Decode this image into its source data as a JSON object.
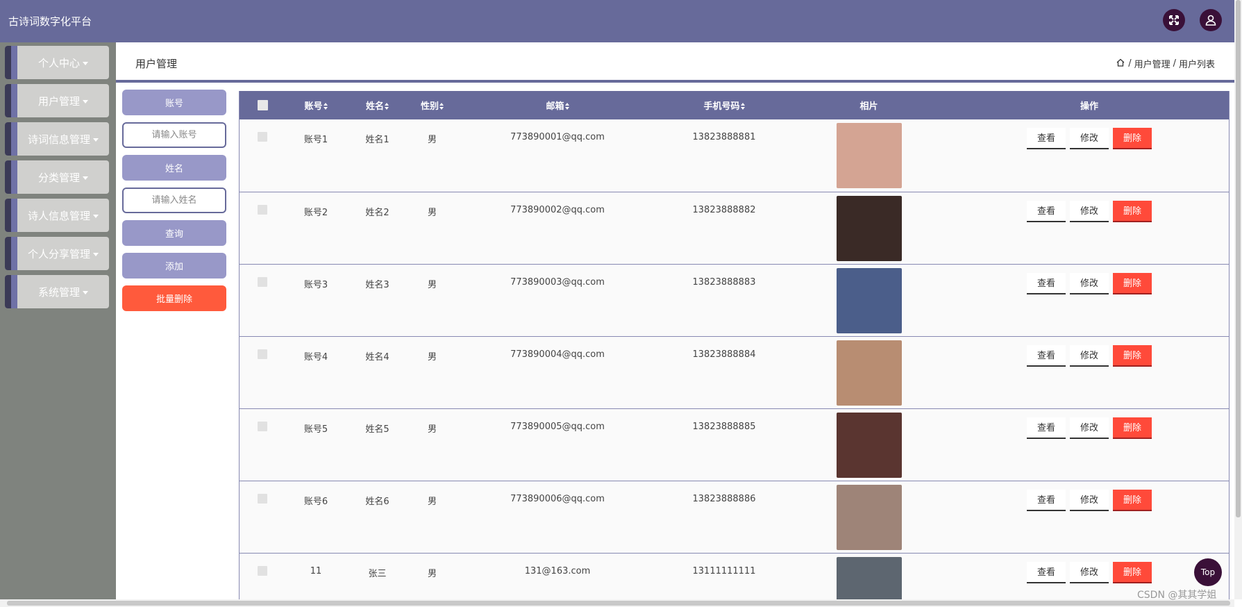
{
  "header": {
    "title": "古诗词数字化平台"
  },
  "sidebar": {
    "items": [
      {
        "label": "个人中心"
      },
      {
        "label": "用户管理"
      },
      {
        "label": "诗词信息管理"
      },
      {
        "label": "分类管理"
      },
      {
        "label": "诗人信息管理"
      },
      {
        "label": "个人分享管理"
      },
      {
        "label": "系统管理"
      }
    ]
  },
  "page": {
    "title": "用户管理",
    "breadcrumb": [
      "用户管理",
      "用户列表"
    ],
    "breadcrumb_sep": "/"
  },
  "search": {
    "account_label": "账号",
    "account_placeholder": "请输入账号",
    "name_label": "姓名",
    "name_value": "请输入姓名",
    "query_label": "查询",
    "add_label": "添加",
    "batch_delete_label": "批量删除"
  },
  "table": {
    "headers": {
      "account": "账号",
      "name": "姓名",
      "gender": "性别",
      "email": "邮箱",
      "phone": "手机号码",
      "photo": "相片",
      "actions": "操作"
    },
    "rows": [
      {
        "account": "账号1",
        "name": "姓名1",
        "gender": "男",
        "email": "773890001@qq.com",
        "phone": "13823888881",
        "photo_color": "#d4a493"
      },
      {
        "account": "账号2",
        "name": "姓名2",
        "gender": "男",
        "email": "773890002@qq.com",
        "phone": "13823888882",
        "photo_color": "#3a2a26"
      },
      {
        "account": "账号3",
        "name": "姓名3",
        "gender": "男",
        "email": "773890003@qq.com",
        "phone": "13823888883",
        "photo_color": "#4b5e8a"
      },
      {
        "account": "账号4",
        "name": "姓名4",
        "gender": "男",
        "email": "773890004@qq.com",
        "phone": "13823888884",
        "photo_color": "#b88d72"
      },
      {
        "account": "账号5",
        "name": "姓名5",
        "gender": "男",
        "email": "773890005@qq.com",
        "phone": "13823888885",
        "photo_color": "#5a3530"
      },
      {
        "account": "账号6",
        "name": "姓名6",
        "gender": "男",
        "email": "773890006@qq.com",
        "phone": "13823888886",
        "photo_color": "#9e8478"
      },
      {
        "account": "11",
        "name": "张三",
        "gender": "男",
        "email": "131@163.com",
        "phone": "13111111111",
        "photo_color": "#5d6670"
      }
    ],
    "actions": {
      "view": "查看",
      "edit": "修改",
      "delete": "删除"
    }
  },
  "top_button": "Top",
  "watermark": "CSDN @其其学姐",
  "colors": {
    "primary": "#676a9a",
    "accent_light": "#9898c8",
    "danger": "#ff5a3c",
    "dark": "#3a1038"
  }
}
